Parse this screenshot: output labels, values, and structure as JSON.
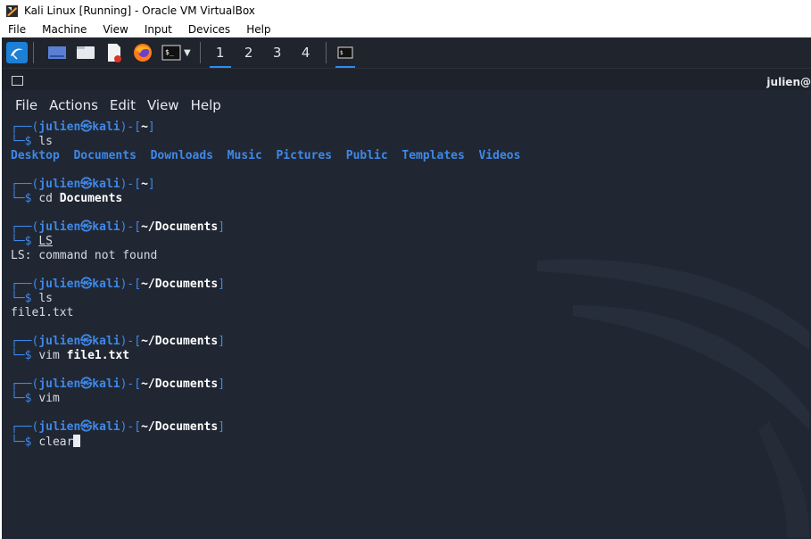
{
  "host": {
    "title": "Kali Linux [Running] - Oracle VM VirtualBox",
    "menu": [
      "File",
      "Machine",
      "View",
      "Input",
      "Devices",
      "Help"
    ]
  },
  "panel": {
    "launchers": [
      "kali-menu-icon",
      "desktop-icon",
      "file-manager-icon",
      "text-editor-icon",
      "firefox-icon",
      "terminal-icon"
    ],
    "workspaces": [
      "1",
      "2",
      "3",
      "4"
    ],
    "active_workspace": "1"
  },
  "terminal": {
    "user_label": "julien@",
    "menu": [
      "File",
      "Actions",
      "Edit",
      "View",
      "Help"
    ],
    "prompt_user": "julien",
    "prompt_at": "㉿",
    "prompt_host": "kali",
    "dollar": "$",
    "ls_dirs": [
      "Desktop",
      "Documents",
      "Downloads",
      "Music",
      "Pictures",
      "Public",
      "Templates",
      "Videos"
    ],
    "session": [
      {
        "cwd": "~",
        "cmd": "ls",
        "arg": "",
        "out": "ls_dirs"
      },
      {
        "cwd": "~",
        "cmd": "cd",
        "arg": "Documents",
        "out": ""
      },
      {
        "cwd": "~/Documents",
        "cmd": "LS",
        "arg": "",
        "out": "LS: command not found"
      },
      {
        "cwd": "~/Documents",
        "cmd": "ls",
        "arg": "",
        "out": "file1.txt"
      },
      {
        "cwd": "~/Documents",
        "cmd": "vim",
        "arg": "file1.txt",
        "out": ""
      },
      {
        "cwd": "~/Documents",
        "cmd": "vim",
        "arg": "",
        "out": ""
      },
      {
        "cwd": "~/Documents",
        "cmd": "clear",
        "arg": "",
        "out": ""
      }
    ]
  },
  "colors": {
    "background": "#202733",
    "accent": "#2f8cf0",
    "prompt_blue": "#3f88e8"
  }
}
